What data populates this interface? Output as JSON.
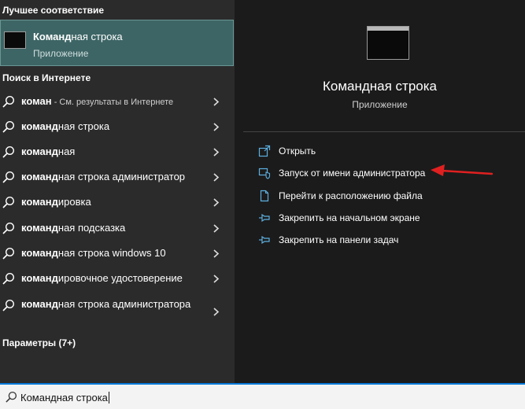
{
  "left_panel": {
    "best_match_heading": "Лучшее соответствие",
    "best_match": {
      "title_bold": "Команд",
      "title_rest": "ная строка",
      "subtitle": "Приложение",
      "icon": "console-icon"
    },
    "web_heading": "Поиск в Интернете",
    "web_results": [
      {
        "bold": "коман",
        "rest": "",
        "hint": " - См. результаты в Интернете"
      },
      {
        "bold": "команд",
        "rest": "ная строка",
        "hint": ""
      },
      {
        "bold": "команд",
        "rest": "ная",
        "hint": ""
      },
      {
        "bold": "команд",
        "rest": "ная строка администратор",
        "hint": ""
      },
      {
        "bold": "команд",
        "rest": "ировка",
        "hint": ""
      },
      {
        "bold": "команд",
        "rest": "ная подсказка",
        "hint": ""
      },
      {
        "bold": "команд",
        "rest": "ная строка windows 10",
        "hint": ""
      },
      {
        "bold": "команд",
        "rest": "ировочное удостоверение",
        "hint": ""
      },
      {
        "bold": "команд",
        "rest": "ная строка администратора",
        "hint": ""
      }
    ],
    "settings_heading": "Параметры (7+)"
  },
  "right_panel": {
    "app_title": "Командная строка",
    "app_subtitle": "Приложение",
    "actions": [
      {
        "label": "Открыть",
        "icon": "open-icon"
      },
      {
        "label": "Запуск от имени администратора",
        "icon": "shield-run-admin-icon"
      },
      {
        "label": "Перейти к расположению файла",
        "icon": "file-location-icon"
      },
      {
        "label": "Закрепить на начальном экране",
        "icon": "pin-icon"
      },
      {
        "label": "Закрепить на панели задач",
        "icon": "pin-icon"
      }
    ]
  },
  "search_bar": {
    "query": "Командная строка",
    "icon": "search-icon"
  },
  "colors": {
    "accent": "#0078d7",
    "highlight": "#3e6565",
    "action_icon": "#5dafe0",
    "annotation_arrow": "#e02020"
  }
}
